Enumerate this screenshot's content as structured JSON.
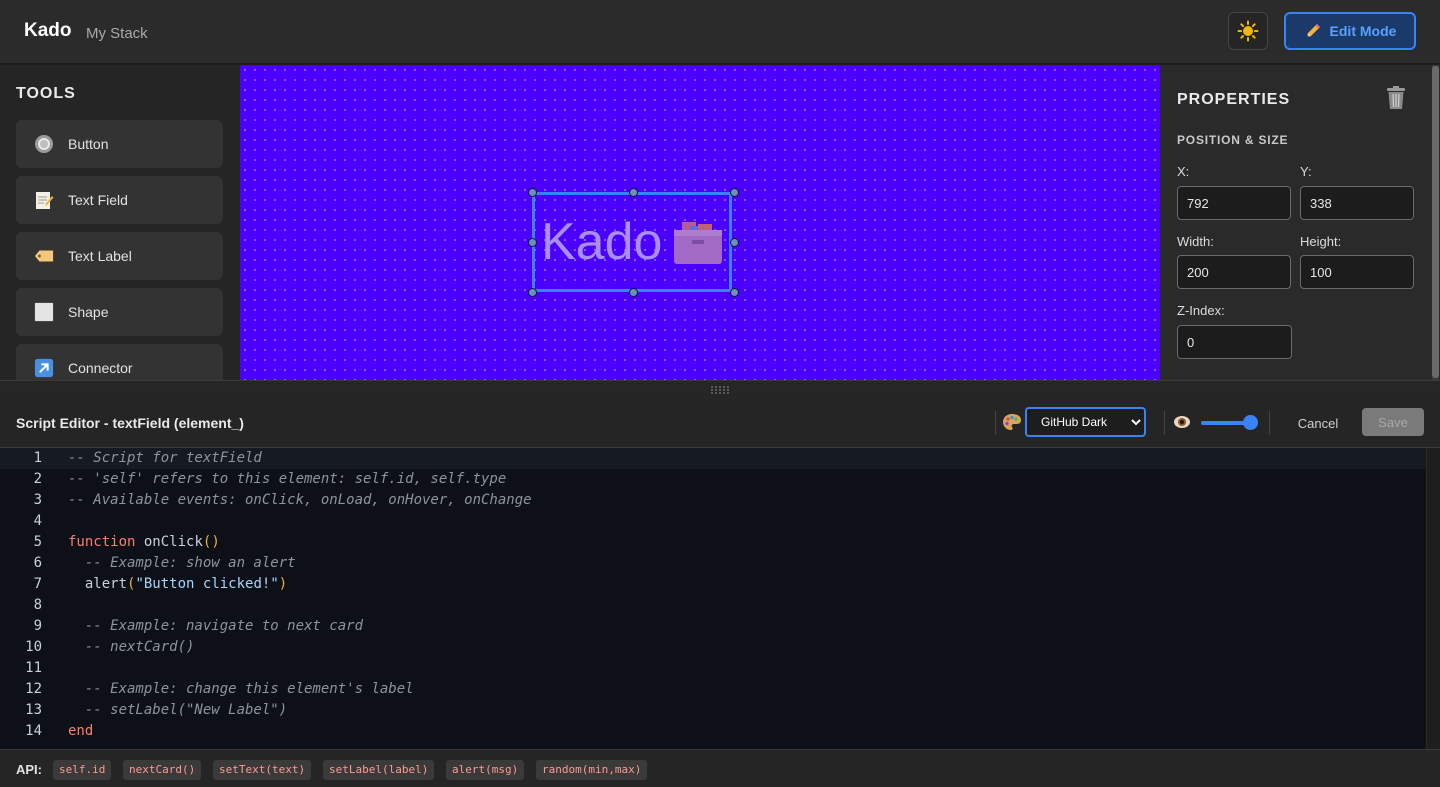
{
  "header": {
    "app_title": "Kado",
    "stack_name": "My Stack",
    "theme_toggle_icon": "sun-icon",
    "edit_mode_label": "Edit Mode"
  },
  "tools": {
    "title": "TOOLS",
    "items": [
      {
        "label": "Button",
        "icon": "radio-button-icon"
      },
      {
        "label": "Text Field",
        "icon": "memo-icon"
      },
      {
        "label": "Text Label",
        "icon": "tag-icon"
      },
      {
        "label": "Shape",
        "icon": "square-icon"
      },
      {
        "label": "Connector",
        "icon": "arrow-up-right-icon"
      }
    ]
  },
  "canvas": {
    "background_color": "#4b00ff",
    "selected_element_text": "Kado"
  },
  "properties": {
    "title": "PROPERTIES",
    "section_title": "POSITION & SIZE",
    "x_label": "X:",
    "x_value": "792",
    "y_label": "Y:",
    "y_value": "338",
    "width_label": "Width:",
    "width_value": "200",
    "height_label": "Height:",
    "height_value": "100",
    "z_label": "Z-Index:",
    "z_value": "0"
  },
  "editor": {
    "title": "Script Editor - textField (element_)",
    "theme_selected": "GitHub Dark",
    "opacity_value": 1.0,
    "cancel_label": "Cancel",
    "save_label": "Save",
    "line_numbers": [
      "1",
      "2",
      "3",
      "4",
      "5",
      "6",
      "7",
      "8",
      "9",
      "10",
      "11",
      "12",
      "13",
      "14"
    ],
    "lines": [
      "-- Script for textField",
      "-- 'self' refers to this element: self.id, self.type",
      "-- Available events: onClick, onLoad, onHover, onChange",
      "",
      "function onClick()",
      "  -- Example: show an alert",
      "  alert(\"Button clicked!\")",
      "",
      "  -- Example: navigate to next card",
      "  -- nextCard()",
      "",
      "  -- Example: change this element's label",
      "  -- setLabel(\"New Label\")",
      "end"
    ]
  },
  "api": {
    "label": "API:",
    "items": [
      "self.id",
      "nextCard()",
      "setText(text)",
      "setLabel(label)",
      "alert(msg)",
      "random(min,max)"
    ]
  }
}
